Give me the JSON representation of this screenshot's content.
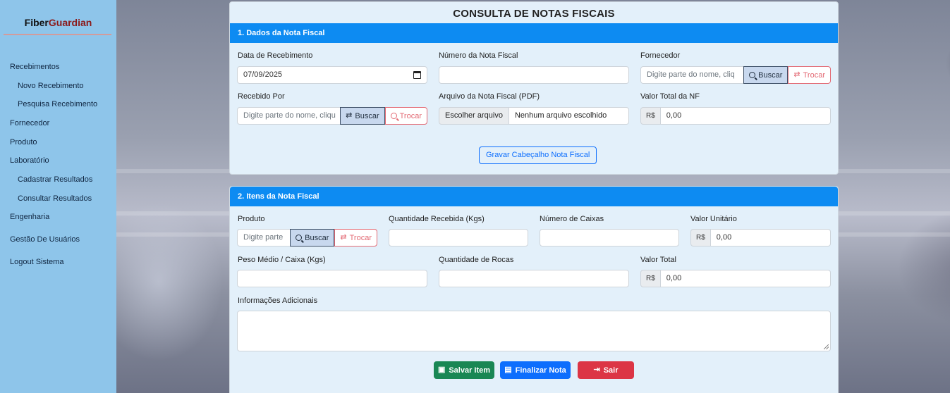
{
  "brand": {
    "part1": "Fiber",
    "part2": "Guardian"
  },
  "sidebar": {
    "items": [
      {
        "label": "Recebimentos"
      },
      {
        "label": "Novo Recebimento"
      },
      {
        "label": "Pesquisa Recebimento"
      },
      {
        "label": "Fornecedor"
      },
      {
        "label": "Produto"
      },
      {
        "label": "Laboratório"
      },
      {
        "label": "Cadastrar Resultados"
      },
      {
        "label": "Consultar Resultados"
      },
      {
        "label": "Engenharia"
      },
      {
        "label": "Gestão De Usuários"
      },
      {
        "label": "Logout Sistema"
      }
    ]
  },
  "page": {
    "title": "CONSULTA DE NOTAS FISCAIS"
  },
  "section1": {
    "title": "1. Dados da Nota Fiscal",
    "data_recebimento": {
      "label": "Data de Recebimento",
      "value": "07/09/2025"
    },
    "numero_nf": {
      "label": "Número da Nota Fiscal",
      "value": ""
    },
    "fornecedor": {
      "label": "Fornecedor",
      "placeholder": "Digite parte do nome, cliq"
    },
    "recebido_por": {
      "label": "Recebido Por",
      "placeholder": "Digite parte do nome, cliqu"
    },
    "arquivo": {
      "label": "Arquivo da Nota Fiscal (PDF)",
      "button": "Escolher arquivo",
      "status": "Nenhum arquivo escolhido"
    },
    "valor_total_nf": {
      "label": "Valor Total da NF",
      "prefix": "R$",
      "value": "0,00"
    },
    "gravar_button": "Gravar Cabeçalho Nota Fiscal"
  },
  "section2": {
    "title": "2. Itens da Nota Fiscal",
    "produto": {
      "label": "Produto",
      "placeholder": "Digite parte"
    },
    "quantidade": {
      "label": "Quantidade Recebida (Kgs)",
      "value": ""
    },
    "numero_caixas": {
      "label": "Número de Caixas",
      "value": ""
    },
    "valor_unitario": {
      "label": "Valor Unitário",
      "prefix": "R$",
      "value": "0,00"
    },
    "peso_medio": {
      "label": "Peso Médio / Caixa (Kgs)",
      "value": ""
    },
    "quantidade_rocas": {
      "label": "Quantidade de Rocas",
      "value": ""
    },
    "valor_total": {
      "label": "Valor Total",
      "prefix": "R$",
      "value": "0,00"
    },
    "info_adicionais": {
      "label": "Informações Adicionais",
      "value": ""
    },
    "salvar_button": "Salvar Item",
    "finalizar_button": "Finalizar Nota",
    "sair_button": "Sair"
  },
  "common": {
    "buscar": "Buscar",
    "trocar": "Trocar"
  },
  "icons": {
    "calendar": "calendar-icon",
    "search": "search-icon",
    "swap": "swap-icon",
    "save": "save-icon",
    "file": "file-icon",
    "exit": "exit-icon"
  },
  "colors": {
    "sidebar": "#8ec5ea",
    "section_bar": "#0d8bf2",
    "panel": "#e3f0fa",
    "save": "#198754",
    "finalize": "#0d6efd",
    "exit": "#dc3545",
    "trocar": "#e36a74",
    "brand_accent": "#8b1a1a"
  }
}
